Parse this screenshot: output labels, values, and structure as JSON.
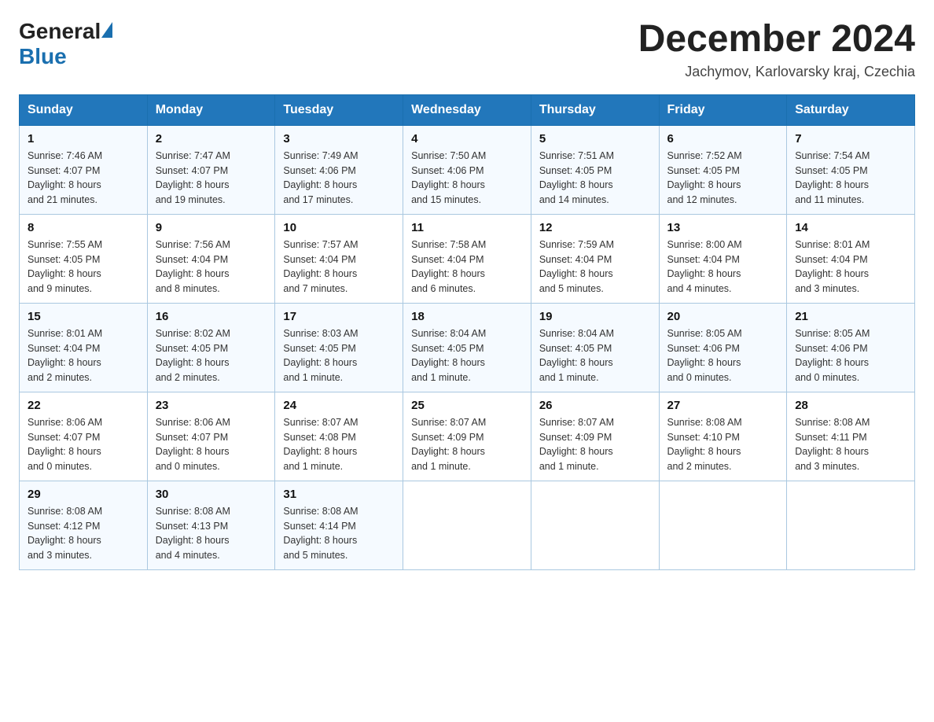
{
  "header": {
    "logo_general": "General",
    "logo_blue": "Blue",
    "month_title": "December 2024",
    "location": "Jachymov, Karlovarsky kraj, Czechia"
  },
  "weekdays": [
    "Sunday",
    "Monday",
    "Tuesday",
    "Wednesday",
    "Thursday",
    "Friday",
    "Saturday"
  ],
  "weeks": [
    [
      {
        "day": "1",
        "sunrise": "7:46 AM",
        "sunset": "4:07 PM",
        "daylight": "8 hours and 21 minutes."
      },
      {
        "day": "2",
        "sunrise": "7:47 AM",
        "sunset": "4:07 PM",
        "daylight": "8 hours and 19 minutes."
      },
      {
        "day": "3",
        "sunrise": "7:49 AM",
        "sunset": "4:06 PM",
        "daylight": "8 hours and 17 minutes."
      },
      {
        "day": "4",
        "sunrise": "7:50 AM",
        "sunset": "4:06 PM",
        "daylight": "8 hours and 15 minutes."
      },
      {
        "day": "5",
        "sunrise": "7:51 AM",
        "sunset": "4:05 PM",
        "daylight": "8 hours and 14 minutes."
      },
      {
        "day": "6",
        "sunrise": "7:52 AM",
        "sunset": "4:05 PM",
        "daylight": "8 hours and 12 minutes."
      },
      {
        "day": "7",
        "sunrise": "7:54 AM",
        "sunset": "4:05 PM",
        "daylight": "8 hours and 11 minutes."
      }
    ],
    [
      {
        "day": "8",
        "sunrise": "7:55 AM",
        "sunset": "4:05 PM",
        "daylight": "8 hours and 9 minutes."
      },
      {
        "day": "9",
        "sunrise": "7:56 AM",
        "sunset": "4:04 PM",
        "daylight": "8 hours and 8 minutes."
      },
      {
        "day": "10",
        "sunrise": "7:57 AM",
        "sunset": "4:04 PM",
        "daylight": "8 hours and 7 minutes."
      },
      {
        "day": "11",
        "sunrise": "7:58 AM",
        "sunset": "4:04 PM",
        "daylight": "8 hours and 6 minutes."
      },
      {
        "day": "12",
        "sunrise": "7:59 AM",
        "sunset": "4:04 PM",
        "daylight": "8 hours and 5 minutes."
      },
      {
        "day": "13",
        "sunrise": "8:00 AM",
        "sunset": "4:04 PM",
        "daylight": "8 hours and 4 minutes."
      },
      {
        "day": "14",
        "sunrise": "8:01 AM",
        "sunset": "4:04 PM",
        "daylight": "8 hours and 3 minutes."
      }
    ],
    [
      {
        "day": "15",
        "sunrise": "8:01 AM",
        "sunset": "4:04 PM",
        "daylight": "8 hours and 2 minutes."
      },
      {
        "day": "16",
        "sunrise": "8:02 AM",
        "sunset": "4:05 PM",
        "daylight": "8 hours and 2 minutes."
      },
      {
        "day": "17",
        "sunrise": "8:03 AM",
        "sunset": "4:05 PM",
        "daylight": "8 hours and 1 minute."
      },
      {
        "day": "18",
        "sunrise": "8:04 AM",
        "sunset": "4:05 PM",
        "daylight": "8 hours and 1 minute."
      },
      {
        "day": "19",
        "sunrise": "8:04 AM",
        "sunset": "4:05 PM",
        "daylight": "8 hours and 1 minute."
      },
      {
        "day": "20",
        "sunrise": "8:05 AM",
        "sunset": "4:06 PM",
        "daylight": "8 hours and 0 minutes."
      },
      {
        "day": "21",
        "sunrise": "8:05 AM",
        "sunset": "4:06 PM",
        "daylight": "8 hours and 0 minutes."
      }
    ],
    [
      {
        "day": "22",
        "sunrise": "8:06 AM",
        "sunset": "4:07 PM",
        "daylight": "8 hours and 0 minutes."
      },
      {
        "day": "23",
        "sunrise": "8:06 AM",
        "sunset": "4:07 PM",
        "daylight": "8 hours and 0 minutes."
      },
      {
        "day": "24",
        "sunrise": "8:07 AM",
        "sunset": "4:08 PM",
        "daylight": "8 hours and 1 minute."
      },
      {
        "day": "25",
        "sunrise": "8:07 AM",
        "sunset": "4:09 PM",
        "daylight": "8 hours and 1 minute."
      },
      {
        "day": "26",
        "sunrise": "8:07 AM",
        "sunset": "4:09 PM",
        "daylight": "8 hours and 1 minute."
      },
      {
        "day": "27",
        "sunrise": "8:08 AM",
        "sunset": "4:10 PM",
        "daylight": "8 hours and 2 minutes."
      },
      {
        "day": "28",
        "sunrise": "8:08 AM",
        "sunset": "4:11 PM",
        "daylight": "8 hours and 3 minutes."
      }
    ],
    [
      {
        "day": "29",
        "sunrise": "8:08 AM",
        "sunset": "4:12 PM",
        "daylight": "8 hours and 3 minutes."
      },
      {
        "day": "30",
        "sunrise": "8:08 AM",
        "sunset": "4:13 PM",
        "daylight": "8 hours and 4 minutes."
      },
      {
        "day": "31",
        "sunrise": "8:08 AM",
        "sunset": "4:14 PM",
        "daylight": "8 hours and 5 minutes."
      },
      null,
      null,
      null,
      null
    ]
  ],
  "labels": {
    "sunrise": "Sunrise:",
    "sunset": "Sunset:",
    "daylight": "Daylight:"
  }
}
